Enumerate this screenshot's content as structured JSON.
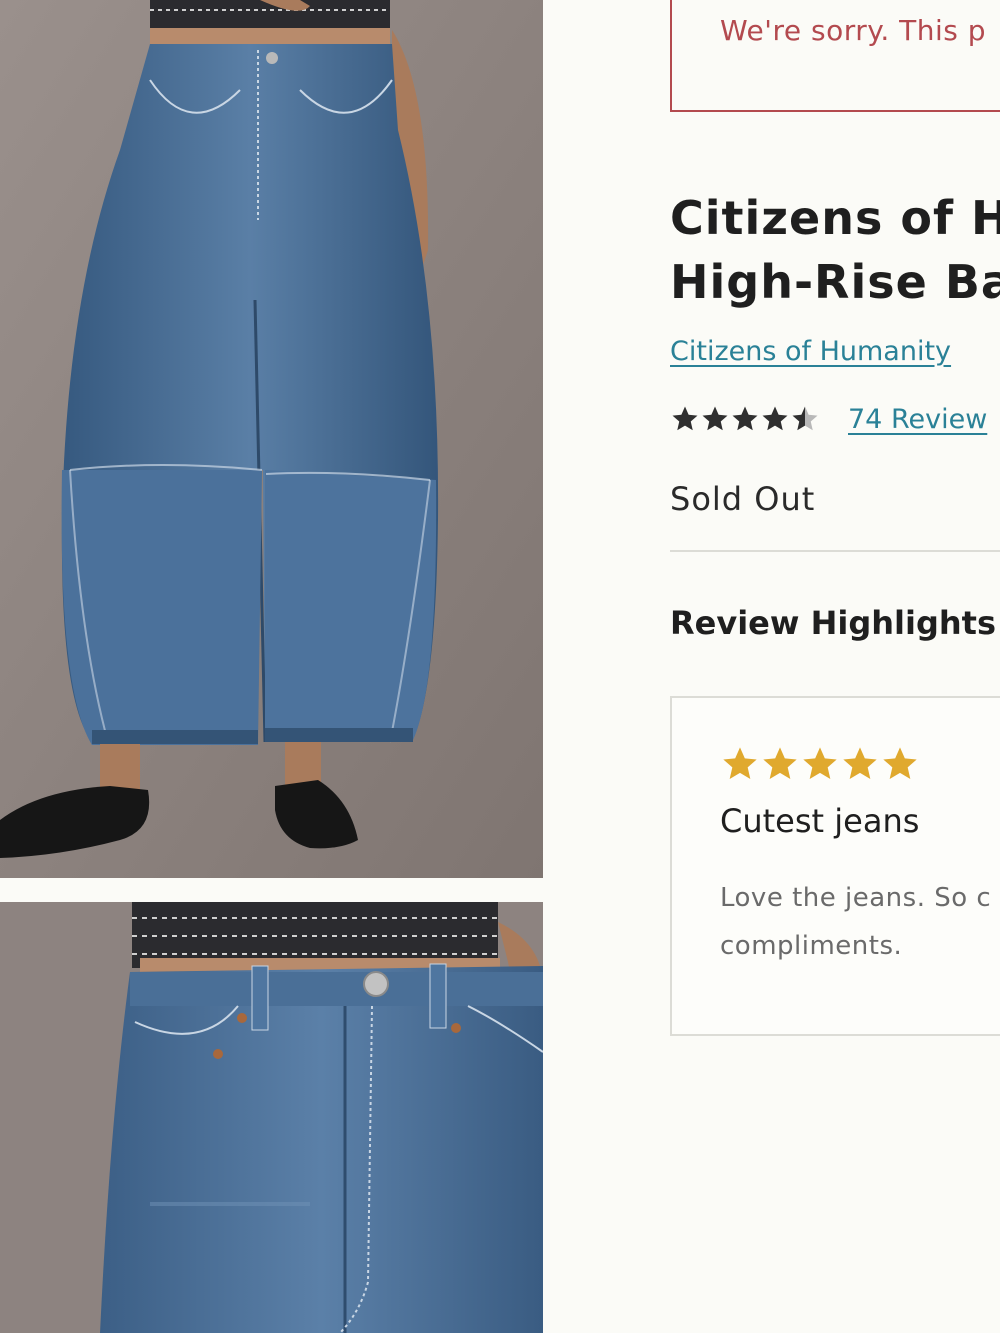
{
  "alert": {
    "text": "We're sorry. This p"
  },
  "product": {
    "title_line_1": "Citizens of H",
    "title_line_2": "High-Rise Ba",
    "brand": "Citizens of Humanity",
    "rating": 4.5,
    "rating_max": 5,
    "reviews_label": "74 Review",
    "status": "Sold Out"
  },
  "highlights": {
    "heading": "Review Highlights",
    "review": {
      "rating": 5,
      "title": "Cutest jeans",
      "body_line_1": "Love the jeans. So c",
      "body_line_2": "compliments."
    }
  },
  "colors": {
    "alert": "#b34a4f",
    "link": "#2a8197",
    "rating_star": "#2f2f2f",
    "review_star": "#e0a92e",
    "denim": "#3f6790",
    "backdrop": "#8f8580"
  },
  "icons": {
    "gallery_image_1": "model-wearing-barrel-jeans-image",
    "gallery_image_2": "barrel-jeans-waist-detail-image",
    "rating_star": "star-icon",
    "review_star": "star-icon"
  }
}
